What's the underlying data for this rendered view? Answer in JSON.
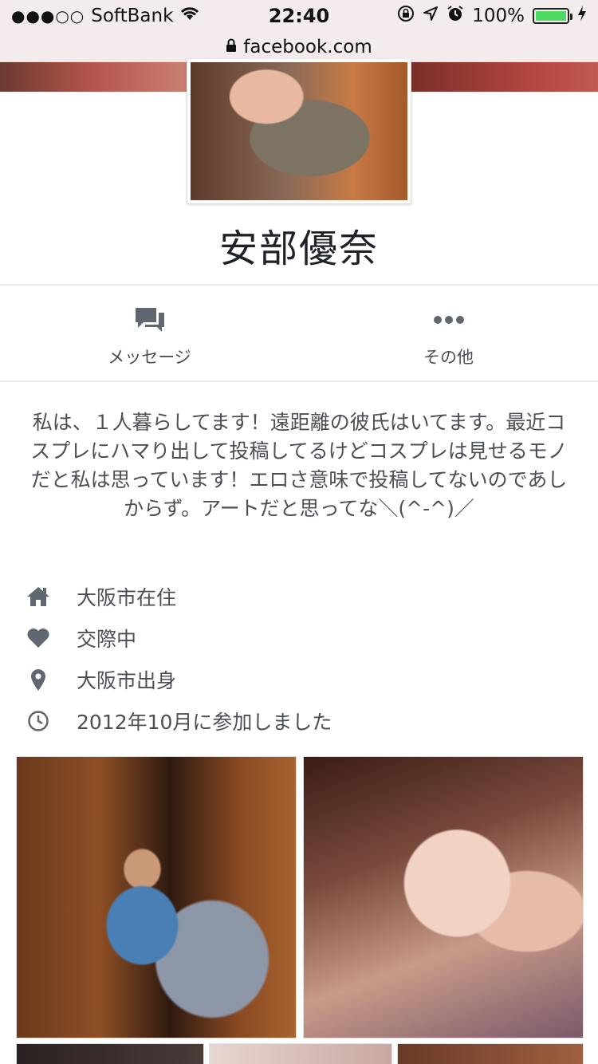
{
  "status_bar": {
    "signal_dots": "●●●○○",
    "carrier": "SoftBank",
    "time": "22:40",
    "battery_percent": "100%"
  },
  "url_bar": {
    "domain": "facebook.com"
  },
  "profile": {
    "name": "安部優奈"
  },
  "actions": [
    {
      "label": "メッセージ",
      "icon": "message-icon"
    },
    {
      "label": "その他",
      "icon": "more-icon"
    }
  ],
  "bio": "私は、１人暮らしてます！遠距離の彼氏はいてます。最近コスプレにハマり出して投稿してるけどコスプレは見せるモノだと私は思っています！エロさ意味で投稿してないのであしからず。アートだと思ってな＼(^-^)／",
  "info": [
    {
      "icon": "home-icon",
      "text": "大阪市在住"
    },
    {
      "icon": "heart-icon",
      "text": "交際中"
    },
    {
      "icon": "location-pin-icon",
      "text": "大阪市出身"
    },
    {
      "icon": "clock-icon",
      "text": "2012年10月に参加しました"
    }
  ],
  "colors": {
    "icon_gray": "#606770",
    "text": "#4b4f56",
    "name": "#1d2129",
    "battery_green": "#4cd964"
  }
}
